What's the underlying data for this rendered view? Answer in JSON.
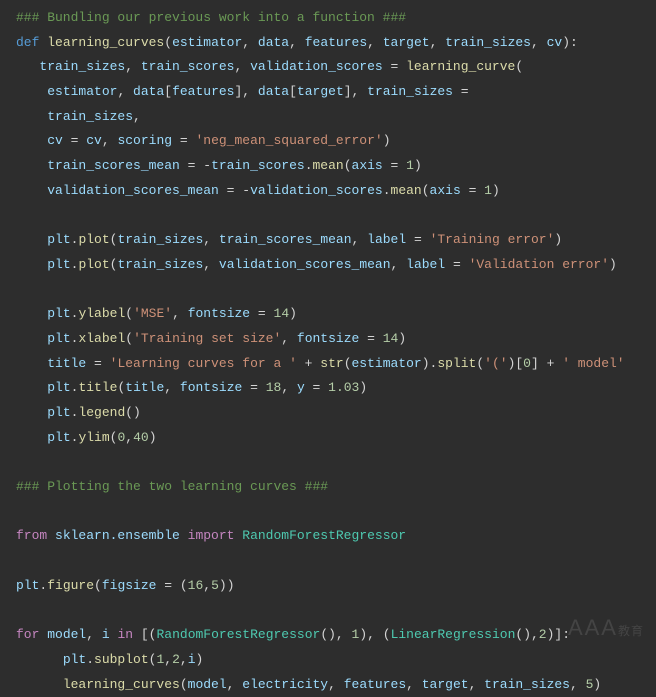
{
  "code": {
    "lines": [
      {
        "indent": 0,
        "tokens": [
          {
            "t": "### Bundling our previous work into a function ###",
            "c": "comment"
          }
        ]
      },
      {
        "indent": 0,
        "tokens": [
          {
            "t": "def ",
            "c": "kw"
          },
          {
            "t": "learning_curves",
            "c": "fn"
          },
          {
            "t": "(",
            "c": "op"
          },
          {
            "t": "estimator",
            "c": "param"
          },
          {
            "t": ", ",
            "c": "op"
          },
          {
            "t": "data",
            "c": "param"
          },
          {
            "t": ", ",
            "c": "op"
          },
          {
            "t": "features",
            "c": "param"
          },
          {
            "t": ", ",
            "c": "op"
          },
          {
            "t": "target",
            "c": "param"
          },
          {
            "t": ", ",
            "c": "op"
          },
          {
            "t": "train_sizes",
            "c": "param"
          },
          {
            "t": ", ",
            "c": "op"
          },
          {
            "t": "cv",
            "c": "param"
          },
          {
            "t": "):",
            "c": "op"
          }
        ]
      },
      {
        "indent": 1,
        "tokens": [
          {
            "t": "train_sizes",
            "c": "param"
          },
          {
            "t": ", ",
            "c": "op"
          },
          {
            "t": "train_scores",
            "c": "param"
          },
          {
            "t": ", ",
            "c": "op"
          },
          {
            "t": "validation_scores",
            "c": "param"
          },
          {
            "t": " = ",
            "c": "op"
          },
          {
            "t": "learning_curve",
            "c": "fn"
          },
          {
            "t": "(",
            "c": "op"
          }
        ]
      },
      {
        "indent": 1,
        "tokens": [
          {
            "t": " ",
            "c": "op"
          },
          {
            "t": "estimator",
            "c": "param"
          },
          {
            "t": ", ",
            "c": "op"
          },
          {
            "t": "data",
            "c": "param"
          },
          {
            "t": "[",
            "c": "op"
          },
          {
            "t": "features",
            "c": "param"
          },
          {
            "t": "], ",
            "c": "op"
          },
          {
            "t": "data",
            "c": "param"
          },
          {
            "t": "[",
            "c": "op"
          },
          {
            "t": "target",
            "c": "param"
          },
          {
            "t": "], ",
            "c": "op"
          },
          {
            "t": "train_sizes",
            "c": "param"
          },
          {
            "t": " =",
            "c": "op"
          }
        ]
      },
      {
        "indent": 1,
        "tokens": [
          {
            "t": " ",
            "c": "op"
          },
          {
            "t": "train_sizes",
            "c": "param"
          },
          {
            "t": ",",
            "c": "op"
          }
        ]
      },
      {
        "indent": 1,
        "tokens": [
          {
            "t": " ",
            "c": "op"
          },
          {
            "t": "cv",
            "c": "param"
          },
          {
            "t": " = ",
            "c": "op"
          },
          {
            "t": "cv",
            "c": "param"
          },
          {
            "t": ", ",
            "c": "op"
          },
          {
            "t": "scoring",
            "c": "param"
          },
          {
            "t": " = ",
            "c": "op"
          },
          {
            "t": "'neg_mean_squared_error'",
            "c": "str"
          },
          {
            "t": ")",
            "c": "op"
          }
        ]
      },
      {
        "indent": 1,
        "tokens": [
          {
            "t": " ",
            "c": "op"
          },
          {
            "t": "train_scores_mean",
            "c": "param"
          },
          {
            "t": " = -",
            "c": "op"
          },
          {
            "t": "train_scores",
            "c": "param"
          },
          {
            "t": ".",
            "c": "op"
          },
          {
            "t": "mean",
            "c": "fn"
          },
          {
            "t": "(",
            "c": "op"
          },
          {
            "t": "axis",
            "c": "param"
          },
          {
            "t": " = ",
            "c": "op"
          },
          {
            "t": "1",
            "c": "num"
          },
          {
            "t": ")",
            "c": "op"
          }
        ]
      },
      {
        "indent": 1,
        "tokens": [
          {
            "t": " ",
            "c": "op"
          },
          {
            "t": "validation_scores_mean",
            "c": "param"
          },
          {
            "t": " = -",
            "c": "op"
          },
          {
            "t": "validation_scores",
            "c": "param"
          },
          {
            "t": ".",
            "c": "op"
          },
          {
            "t": "mean",
            "c": "fn"
          },
          {
            "t": "(",
            "c": "op"
          },
          {
            "t": "axis",
            "c": "param"
          },
          {
            "t": " = ",
            "c": "op"
          },
          {
            "t": "1",
            "c": "num"
          },
          {
            "t": ")",
            "c": "op"
          }
        ]
      },
      {
        "indent": 0,
        "tokens": []
      },
      {
        "indent": 1,
        "tokens": [
          {
            "t": " ",
            "c": "op"
          },
          {
            "t": "plt",
            "c": "param"
          },
          {
            "t": ".",
            "c": "op"
          },
          {
            "t": "plot",
            "c": "fn"
          },
          {
            "t": "(",
            "c": "op"
          },
          {
            "t": "train_sizes",
            "c": "param"
          },
          {
            "t": ", ",
            "c": "op"
          },
          {
            "t": "train_scores_mean",
            "c": "param"
          },
          {
            "t": ", ",
            "c": "op"
          },
          {
            "t": "label",
            "c": "param"
          },
          {
            "t": " = ",
            "c": "op"
          },
          {
            "t": "'Training error'",
            "c": "str"
          },
          {
            "t": ")",
            "c": "op"
          }
        ]
      },
      {
        "indent": 1,
        "tokens": [
          {
            "t": " ",
            "c": "op"
          },
          {
            "t": "plt",
            "c": "param"
          },
          {
            "t": ".",
            "c": "op"
          },
          {
            "t": "plot",
            "c": "fn"
          },
          {
            "t": "(",
            "c": "op"
          },
          {
            "t": "train_sizes",
            "c": "param"
          },
          {
            "t": ", ",
            "c": "op"
          },
          {
            "t": "validation_scores_mean",
            "c": "param"
          },
          {
            "t": ", ",
            "c": "op"
          },
          {
            "t": "label",
            "c": "param"
          },
          {
            "t": " = ",
            "c": "op"
          },
          {
            "t": "'Validation error'",
            "c": "str"
          },
          {
            "t": ")",
            "c": "op"
          }
        ]
      },
      {
        "indent": 0,
        "tokens": []
      },
      {
        "indent": 1,
        "tokens": [
          {
            "t": " ",
            "c": "op"
          },
          {
            "t": "plt",
            "c": "param"
          },
          {
            "t": ".",
            "c": "op"
          },
          {
            "t": "ylabel",
            "c": "fn"
          },
          {
            "t": "(",
            "c": "op"
          },
          {
            "t": "'MSE'",
            "c": "str"
          },
          {
            "t": ", ",
            "c": "op"
          },
          {
            "t": "fontsize",
            "c": "param"
          },
          {
            "t": " = ",
            "c": "op"
          },
          {
            "t": "14",
            "c": "num"
          },
          {
            "t": ")",
            "c": "op"
          }
        ]
      },
      {
        "indent": 1,
        "tokens": [
          {
            "t": " ",
            "c": "op"
          },
          {
            "t": "plt",
            "c": "param"
          },
          {
            "t": ".",
            "c": "op"
          },
          {
            "t": "xlabel",
            "c": "fn"
          },
          {
            "t": "(",
            "c": "op"
          },
          {
            "t": "'Training set size'",
            "c": "str"
          },
          {
            "t": ", ",
            "c": "op"
          },
          {
            "t": "fontsize",
            "c": "param"
          },
          {
            "t": " = ",
            "c": "op"
          },
          {
            "t": "14",
            "c": "num"
          },
          {
            "t": ")",
            "c": "op"
          }
        ]
      },
      {
        "indent": 1,
        "tokens": [
          {
            "t": " ",
            "c": "op"
          },
          {
            "t": "title",
            "c": "param"
          },
          {
            "t": " = ",
            "c": "op"
          },
          {
            "t": "'Learning curves for a '",
            "c": "str"
          },
          {
            "t": " + ",
            "c": "op"
          },
          {
            "t": "str",
            "c": "fn"
          },
          {
            "t": "(",
            "c": "op"
          },
          {
            "t": "estimator",
            "c": "param"
          },
          {
            "t": ").",
            "c": "op"
          },
          {
            "t": "split",
            "c": "fn"
          },
          {
            "t": "(",
            "c": "op"
          },
          {
            "t": "'('",
            "c": "str"
          },
          {
            "t": ")[",
            "c": "op"
          },
          {
            "t": "0",
            "c": "num"
          },
          {
            "t": "] + ",
            "c": "op"
          },
          {
            "t": "' model'",
            "c": "str"
          }
        ]
      },
      {
        "indent": 1,
        "tokens": [
          {
            "t": " ",
            "c": "op"
          },
          {
            "t": "plt",
            "c": "param"
          },
          {
            "t": ".",
            "c": "op"
          },
          {
            "t": "title",
            "c": "fn"
          },
          {
            "t": "(",
            "c": "op"
          },
          {
            "t": "title",
            "c": "param"
          },
          {
            "t": ", ",
            "c": "op"
          },
          {
            "t": "fontsize",
            "c": "param"
          },
          {
            "t": " = ",
            "c": "op"
          },
          {
            "t": "18",
            "c": "num"
          },
          {
            "t": ", ",
            "c": "op"
          },
          {
            "t": "y",
            "c": "param"
          },
          {
            "t": " = ",
            "c": "op"
          },
          {
            "t": "1.03",
            "c": "num"
          },
          {
            "t": ")",
            "c": "op"
          }
        ]
      },
      {
        "indent": 1,
        "tokens": [
          {
            "t": " ",
            "c": "op"
          },
          {
            "t": "plt",
            "c": "param"
          },
          {
            "t": ".",
            "c": "op"
          },
          {
            "t": "legend",
            "c": "fn"
          },
          {
            "t": "()",
            "c": "op"
          }
        ]
      },
      {
        "indent": 1,
        "tokens": [
          {
            "t": " ",
            "c": "op"
          },
          {
            "t": "plt",
            "c": "param"
          },
          {
            "t": ".",
            "c": "op"
          },
          {
            "t": "ylim",
            "c": "fn"
          },
          {
            "t": "(",
            "c": "op"
          },
          {
            "t": "0",
            "c": "num"
          },
          {
            "t": ",",
            "c": "op"
          },
          {
            "t": "40",
            "c": "num"
          },
          {
            "t": ")",
            "c": "op"
          }
        ]
      },
      {
        "indent": 0,
        "tokens": []
      },
      {
        "indent": 0,
        "tokens": [
          {
            "t": "### Plotting the two learning curves ###",
            "c": "comment"
          }
        ]
      },
      {
        "indent": 0,
        "tokens": []
      },
      {
        "indent": 0,
        "tokens": [
          {
            "t": "from ",
            "c": "builtin"
          },
          {
            "t": "sklearn.ensemble",
            "c": "param"
          },
          {
            "t": " import ",
            "c": "builtin"
          },
          {
            "t": "RandomForestRegressor",
            "c": "cls"
          }
        ]
      },
      {
        "indent": 0,
        "tokens": []
      },
      {
        "indent": 0,
        "tokens": [
          {
            "t": "plt",
            "c": "param"
          },
          {
            "t": ".",
            "c": "op"
          },
          {
            "t": "figure",
            "c": "fn"
          },
          {
            "t": "(",
            "c": "op"
          },
          {
            "t": "figsize",
            "c": "param"
          },
          {
            "t": " = (",
            "c": "op"
          },
          {
            "t": "16",
            "c": "num"
          },
          {
            "t": ",",
            "c": "op"
          },
          {
            "t": "5",
            "c": "num"
          },
          {
            "t": "))",
            "c": "op"
          }
        ]
      },
      {
        "indent": 0,
        "tokens": []
      },
      {
        "indent": 0,
        "tokens": [
          {
            "t": "for ",
            "c": "builtin"
          },
          {
            "t": "model",
            "c": "param"
          },
          {
            "t": ", ",
            "c": "op"
          },
          {
            "t": "i",
            "c": "param"
          },
          {
            "t": " in ",
            "c": "builtin"
          },
          {
            "t": "[(",
            "c": "op"
          },
          {
            "t": "RandomForestRegressor",
            "c": "cls"
          },
          {
            "t": "(), ",
            "c": "op"
          },
          {
            "t": "1",
            "c": "num"
          },
          {
            "t": "), (",
            "c": "op"
          },
          {
            "t": "LinearRegression",
            "c": "cls"
          },
          {
            "t": "(),",
            "c": "op"
          },
          {
            "t": "2",
            "c": "num"
          },
          {
            "t": ")]:",
            "c": "op"
          }
        ]
      },
      {
        "indent": 2,
        "tokens": [
          {
            "t": "plt",
            "c": "param"
          },
          {
            "t": ".",
            "c": "op"
          },
          {
            "t": "subplot",
            "c": "fn"
          },
          {
            "t": "(",
            "c": "op"
          },
          {
            "t": "1",
            "c": "num"
          },
          {
            "t": ",",
            "c": "op"
          },
          {
            "t": "2",
            "c": "num"
          },
          {
            "t": ",",
            "c": "op"
          },
          {
            "t": "i",
            "c": "param"
          },
          {
            "t": ")",
            "c": "op"
          }
        ]
      },
      {
        "indent": 2,
        "tokens": [
          {
            "t": "learning_curves",
            "c": "fn"
          },
          {
            "t": "(",
            "c": "op"
          },
          {
            "t": "model",
            "c": "param"
          },
          {
            "t": ", ",
            "c": "op"
          },
          {
            "t": "electricity",
            "c": "param"
          },
          {
            "t": ", ",
            "c": "op"
          },
          {
            "t": "features",
            "c": "param"
          },
          {
            "t": ", ",
            "c": "op"
          },
          {
            "t": "target",
            "c": "param"
          },
          {
            "t": ", ",
            "c": "op"
          },
          {
            "t": "train_sizes",
            "c": "param"
          },
          {
            "t": ", ",
            "c": "op"
          },
          {
            "t": "5",
            "c": "num"
          },
          {
            "t": ")",
            "c": "op"
          }
        ]
      }
    ]
  },
  "watermark": {
    "big": "AAA",
    "small": "教育"
  }
}
